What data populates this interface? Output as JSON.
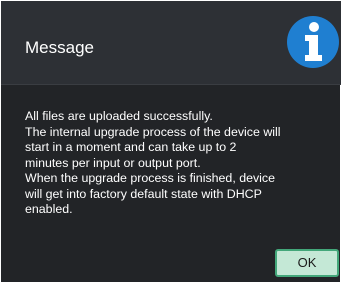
{
  "dialog": {
    "title": "Message",
    "icon": "info-icon",
    "message_lines": [
      "All files are uploaded successfully.",
      "The internal upgrade process of the device will",
      "start in a moment and can take up to 2",
      "minutes per input or output port.",
      "When the upgrade process is finished, device",
      "will get into factory default state with DHCP",
      "enabled."
    ],
    "ok_label": "OK"
  },
  "colors": {
    "background": "#222427",
    "header": "#2d3035",
    "icon_blue": "#1f7fd1",
    "ok_fill": "#c4e8d6",
    "ok_border": "#43a77a"
  }
}
